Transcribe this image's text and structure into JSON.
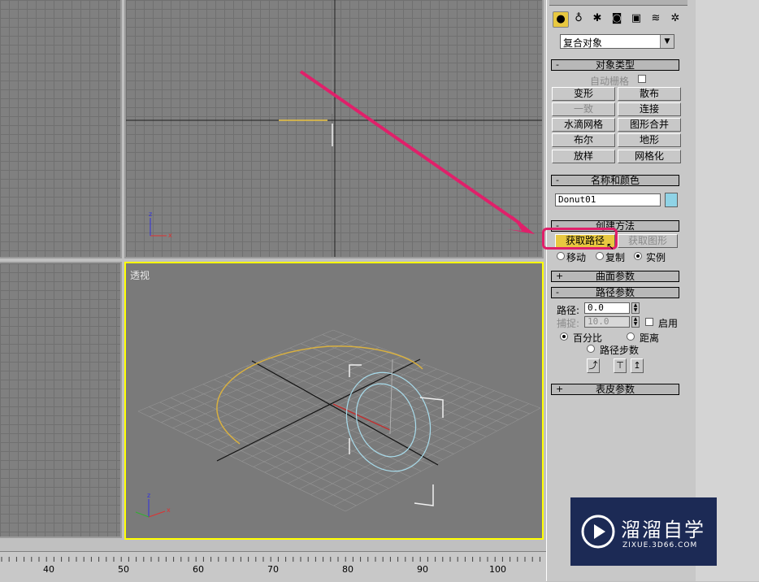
{
  "viewports": {
    "perspective_label": "透视"
  },
  "ruler": {
    "ticks": [
      "40",
      "50",
      "60",
      "70",
      "80",
      "90",
      "100"
    ]
  },
  "command_panel": {
    "category_dropdown": "复合对象",
    "object_type": {
      "title": "对象类型",
      "autogrid_label": "自动栅格",
      "buttons": [
        "变形",
        "散布",
        "一致",
        "连接",
        "水滴网格",
        "图形合并",
        "布尔",
        "地形",
        "放样",
        "网格化"
      ]
    },
    "name_color": {
      "title": "名称和颜色",
      "name_value": "Donut01",
      "swatch_color": "#8fd3e6"
    },
    "creation_method": {
      "title": "创建方法",
      "get_path": "获取路径",
      "get_shape": "获取图形",
      "move": "移动",
      "copy": "复制",
      "instance": "实例"
    },
    "surface_params": {
      "title": "曲面参数"
    },
    "path_params": {
      "title": "路径参数",
      "path_label": "路径:",
      "path_value": "0.0",
      "snap_label": "捕捉:",
      "snap_value": "10.0",
      "enable_label": "启用",
      "percentage_label": "百分比",
      "distance_label": "距离",
      "path_steps_label": "路径步数"
    },
    "skin_params": {
      "title": "表皮参数"
    }
  },
  "watermark": {
    "brand": "溜溜自学",
    "url": "ZIXUE.3D66.COM"
  },
  "colors": {
    "highlight": "#e0206a",
    "active_viewport": "#ffff00",
    "path_curve": "#d8b040",
    "donut": "#a8dcec",
    "watermark_bg": "#1c2a55"
  }
}
